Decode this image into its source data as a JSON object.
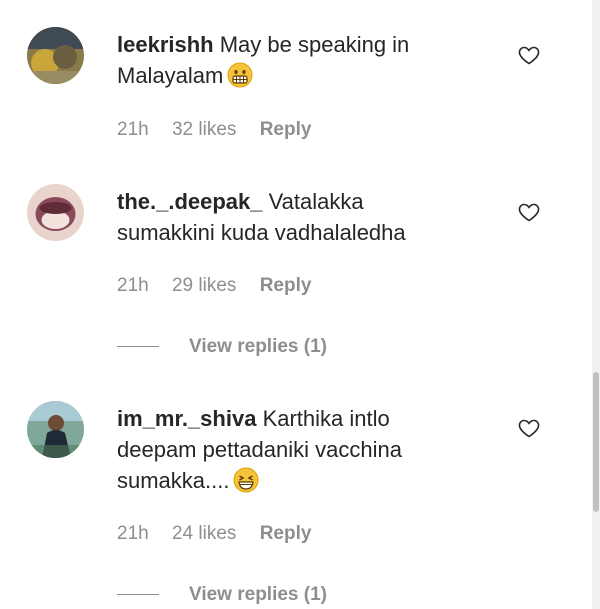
{
  "comments": [
    {
      "username": "leekrishh",
      "text": "May be speaking in Malayalam",
      "emoji": "grimacing-face",
      "time": "21h",
      "likes": "32 likes",
      "reply": "Reply",
      "view_replies": null
    },
    {
      "username": "the._.deepak_",
      "text": "Vatalakka sumakkini kuda vadhalaledha",
      "emoji": null,
      "time": "21h",
      "likes": "29 likes",
      "reply": "Reply",
      "view_replies": "View replies (1)"
    },
    {
      "username": "im_mr._shiva",
      "text": "Karthika intlo deepam pettadaniki vacchina sumakka....",
      "emoji": "grinning-squinting-face",
      "time": "21h",
      "likes": "24 likes",
      "reply": "Reply",
      "view_replies": "View replies (1)"
    }
  ],
  "icons": {
    "like": "heart-outline-icon"
  },
  "colors": {
    "text": "#262626",
    "secondary": "#8e8e8e",
    "emoji": "#f7c33c"
  }
}
